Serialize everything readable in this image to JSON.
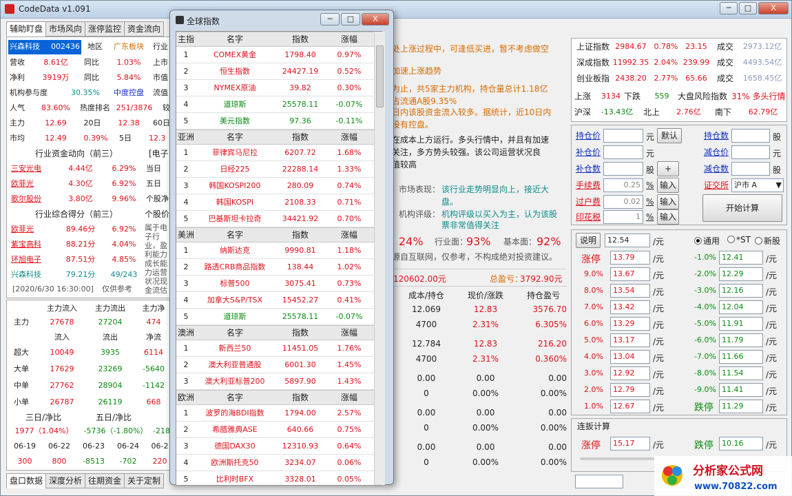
{
  "app": {
    "title": "CodeData v1.091",
    "min": "─",
    "max": "□",
    "close": "X"
  },
  "left_tabs": [
    "辅助盯盘",
    "市场风向",
    "涨停监控",
    "资金流向"
  ],
  "stock": {
    "name": "兴森科技",
    "code": "002436",
    "region_label": "地区",
    "region": "广东板块",
    "industry_label": "行业"
  },
  "info_rows": [
    [
      "营收",
      "8.61亿",
      "同比",
      "1.03%",
      "上市"
    ],
    [
      "净利",
      "3919万",
      "同比",
      "5.84%",
      "市值"
    ],
    [
      "机构参与度",
      "30.35%",
      "中度控盘",
      "流值"
    ],
    [
      "人气",
      "83.60%",
      "热度排名",
      "251/3876",
      "较"
    ],
    [
      "主力",
      "12.69",
      "20日",
      "12.38",
      "60日"
    ],
    [
      "市均",
      "12.49",
      "0.39%",
      "5日",
      "12.3"
    ]
  ],
  "ind_fund": {
    "title": "行业资金动向（前三）",
    "side": "[电子",
    "rows": [
      [
        "三安光电",
        "4.44亿",
        "6.29%",
        "当日"
      ],
      [
        "欧菲光",
        "4.30亿",
        "6.92%",
        "五日"
      ],
      [
        "歌尔股份",
        "3.80亿",
        "9.96%",
        "个股净"
      ]
    ]
  },
  "ind_score": {
    "title": "行业综合得分（前三）",
    "side": "个股价",
    "rows": [
      [
        "欧菲光",
        "89.46分",
        "6.92%"
      ],
      [
        "紫宝高科",
        "88.21分",
        "4.04%"
      ],
      [
        "环旭电子",
        "87.51分",
        "4.85%"
      ],
      [
        "兴森科技",
        "79.21分",
        "49/243"
      ]
    ],
    "note": "属于电子行业，盈利能力成长能力运营状况现金流估值贴近附近，一般。",
    "date": "[2020/6/30 16:30:00]",
    "disclaimer": "仅供参考"
  },
  "flow": {
    "h1": [
      "主力流入",
      "主力流出",
      "主力净"
    ],
    "main": [
      "主力",
      "27678",
      "27204",
      "474"
    ],
    "h2": [
      "流入",
      "流出",
      "净流"
    ],
    "rows": [
      [
        "超大",
        "10049",
        "3935",
        "6114"
      ],
      [
        "大单",
        "17629",
        "23269",
        "-5640"
      ],
      [
        "中单",
        "27762",
        "28904",
        "-1142"
      ],
      [
        "小单",
        "26787",
        "26119",
        "668"
      ]
    ],
    "h3": [
      "三日/净比",
      "五日/净比"
    ],
    "r3": [
      "1977（1.04%）",
      "-5736（-1.80%）",
      "-218"
    ],
    "dates": [
      "06-19",
      "06-22",
      "06-23",
      "06-24",
      "06-2"
    ],
    "dvals": [
      "300",
      "800",
      "-8513",
      "-702",
      "220"
    ]
  },
  "bottom_tabs": [
    "盘口数据",
    "深度分析",
    "往期资金",
    "关于定制"
  ],
  "mid_text": {
    "l1": "处上涨过程中，可逢低买进，暂不考虑做空",
    "l2": "加速上涨趋势",
    "l3": "为止，共5家主力机构，持仓量总计1.18亿",
    "l4": "占流通A股9.35%",
    "l5": "日内该股资金流入较多。据统计，近10日内",
    "l6": "没有控盘。",
    "l7": "在成本上方运行。多头行情中，并且有加速",
    "l8": "关注，多方势头较强。该公司运营状况良",
    "l9": "值较高",
    "mk_label": "市场表现：",
    "mk_text1": "该行业走势明显向上，接近大",
    "mk_text2": "盘。",
    "org_label": "机构评级：",
    "org_text1": "机构评级以买入为主，认为该股",
    "org_text2": "票非常值得关注",
    "score1": "24%",
    "score2_label": "行业面：",
    "score2": "93%",
    "score3_label": "基本面：",
    "score3": "92%",
    "src": "源自互联网，仅参考，不构成绝对投资建议。",
    "asset": "120602.00元",
    "profit_label": "总盈亏：",
    "profit": "3792.90元"
  },
  "hold": {
    "headers": [
      "成本/持仓",
      "现价/涨跌",
      "持仓盈亏"
    ],
    "rows": [
      [
        "12.069",
        "12.83",
        "3576.70"
      ],
      [
        "4700",
        "2.31%",
        "6.305%"
      ],
      [
        "12.784",
        "12.83",
        "216.20"
      ],
      [
        "4700",
        "2.31%",
        "0.360%"
      ],
      [
        "0.00",
        "0.00",
        "0.00"
      ],
      [
        "0",
        "0.00%",
        "0.00%"
      ],
      [
        "0.00",
        "0.00",
        "0.00"
      ],
      [
        "0",
        "0.00%",
        "0.00%"
      ],
      [
        "0.00",
        "0.00",
        "0.00"
      ],
      [
        "0",
        "0.00%",
        "0.00%"
      ]
    ]
  },
  "global": {
    "title": "全球指数",
    "groups": [
      {
        "region": "主指",
        "headers": [
          "名字",
          "指数",
          "涨幅"
        ],
        "rows": [
          [
            "1",
            "COMEX黄金",
            "1798.40",
            "0.97%"
          ],
          [
            "2",
            "恒生指数",
            "24427.19",
            "0.52%"
          ],
          [
            "3",
            "NYMEX原油",
            "39.82",
            "0.30%"
          ],
          [
            "4",
            "道琼斯",
            "25578.11",
            "-0.07%"
          ],
          [
            "5",
            "美元指数",
            "97.36",
            "-0.11%"
          ]
        ]
      },
      {
        "region": "亚洲",
        "headers": [
          "名字",
          "指数",
          "涨幅"
        ],
        "rows": [
          [
            "1",
            "菲律宾马尼拉",
            "6207.72",
            "1.68%"
          ],
          [
            "2",
            "日经225",
            "22288.14",
            "1.33%"
          ],
          [
            "3",
            "韩国KOSPI200",
            "280.09",
            "0.74%"
          ],
          [
            "4",
            "韩国KOSPI",
            "2108.33",
            "0.71%"
          ],
          [
            "5",
            "巴基斯坦卡拉奇",
            "34421.92",
            "0.70%"
          ]
        ]
      },
      {
        "region": "美洲",
        "headers": [
          "名字",
          "指数",
          "涨幅"
        ],
        "rows": [
          [
            "1",
            "纳斯达克",
            "9990.81",
            "1.18%"
          ],
          [
            "2",
            "路透CRB商品指数",
            "138.44",
            "1.02%"
          ],
          [
            "3",
            "标普500",
            "3075.41",
            "0.73%"
          ],
          [
            "4",
            "加拿大S&P/TSX",
            "15452.27",
            "0.41%"
          ],
          [
            "5",
            "道琼斯",
            "25578.11",
            "-0.07%"
          ]
        ]
      },
      {
        "region": "澳洲",
        "headers": [
          "名字",
          "指数",
          "涨幅"
        ],
        "rows": [
          [
            "1",
            "新西兰50",
            "11451.05",
            "1.76%"
          ],
          [
            "2",
            "澳大利亚普通股",
            "6001.30",
            "1.45%"
          ],
          [
            "3",
            "澳大利亚标普200",
            "5897.90",
            "1.43%"
          ]
        ]
      },
      {
        "region": "欧洲",
        "headers": [
          "名字",
          "指数",
          "涨幅"
        ],
        "rows": [
          [
            "1",
            "波罗的海BDI指数",
            "1794.00",
            "2.57%"
          ],
          [
            "2",
            "希腊雅典ASE",
            "640.66",
            "0.75%"
          ],
          [
            "3",
            "德国DAX30",
            "12310.93",
            "0.64%"
          ],
          [
            "4",
            "欧洲斯托克50",
            "3234.07",
            "0.06%"
          ],
          [
            "5",
            "比利时BFX",
            "3328.01",
            "0.05%"
          ]
        ]
      }
    ]
  },
  "market": {
    "rows": [
      [
        "上证指数",
        "2984.67",
        "0.78%",
        "23.15",
        "成交",
        "2973.12亿"
      ],
      [
        "深成指数",
        "11992.35",
        "2.04%",
        "239.99",
        "成交",
        "4493.54亿"
      ],
      [
        "创业板指",
        "2438.20",
        "2.77%",
        "65.66",
        "成交",
        "1658.45亿"
      ]
    ],
    "up_label": "上涨",
    "up": "3134",
    "down_label": "下跌",
    "down": "559",
    "risk_label": "大盘风险指数",
    "risk": "31% 多头行情",
    "hs_label": "沪深",
    "hs": "-13.43亿",
    "north_label": "北上",
    "north": "2.76亿",
    "south_label": "南下",
    "south": "62.79亿"
  },
  "calc": {
    "hold_price": "持仓价",
    "yuan": "元",
    "default_btn": "默认",
    "hold_qty": "持仓数",
    "share": "股",
    "add_price": "补仓价",
    "reduce_price": "减仓价",
    "add_qty": "补仓数",
    "plus": "+",
    "reduce_qty": "减仓数",
    "fee": "手续费",
    "fee_val": "0.25",
    "transfer": "过户费",
    "transfer_val": "0.02",
    "stamp": "印花税",
    "stamp_val": "1",
    "pct": "%",
    "input": "输入",
    "exch": "证交所",
    "exch_val": "沪市 A",
    "start": "开始计算"
  },
  "limit": {
    "explain": "说明",
    "price": "12.54",
    "unit": "/元",
    "modes": [
      "通用",
      "*ST",
      "新股"
    ],
    "up_label": "涨停",
    "up_val": "13.79",
    "down_label": "跌停",
    "down_val": "11.29",
    "rows": [
      [
        "9.0%",
        "13.67",
        "-2.0%",
        "12.29"
      ],
      [
        "8.0%",
        "13.54",
        "-3.0%",
        "12.16"
      ],
      [
        "7.0%",
        "13.42",
        "-4.0%",
        "12.04"
      ],
      [
        "6.0%",
        "13.29",
        "-5.0%",
        "11.91"
      ],
      [
        "5.0%",
        "13.17",
        "-6.0%",
        "11.79"
      ],
      [
        "4.0%",
        "13.04",
        "-7.0%",
        "11.66"
      ],
      [
        "3.0%",
        "12.92",
        "-8.0%",
        "11.54"
      ],
      [
        "2.0%",
        "12.79",
        "-9.0%",
        "11.41"
      ],
      [
        "1.0%",
        "12.67"
      ]
    ],
    "first": [
      "-1.0%",
      "12.41"
    ],
    "cont": "连扳计算",
    "cup": "15.17",
    "cdown": "10.16"
  },
  "logo": {
    "text": "分析家公式网",
    "url": "www.70822.com"
  }
}
